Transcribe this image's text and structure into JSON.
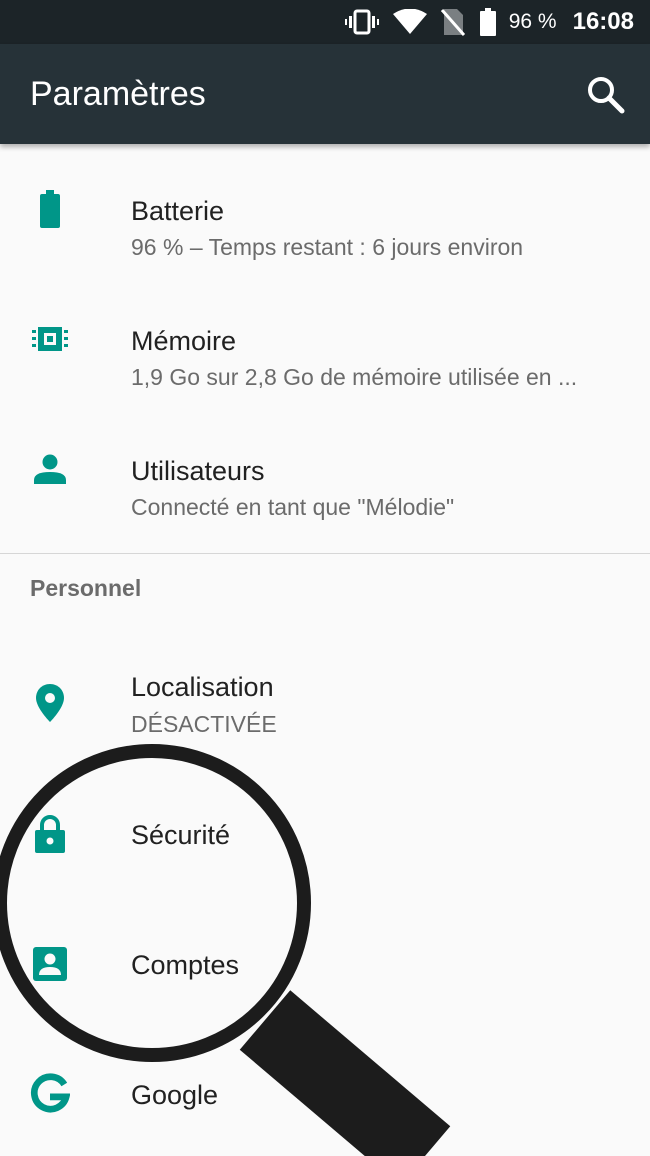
{
  "status_bar": {
    "icons": [
      "vibrate-icon",
      "wifi-icon",
      "no-sim-icon",
      "battery-icon"
    ],
    "battery_percent": "96 %",
    "time": "16:08"
  },
  "toolbar": {
    "title": "Paramètres",
    "search_icon": "search-icon"
  },
  "colors": {
    "toolbar": "#263238",
    "status_bar": "#1c2428",
    "accent": "#009688",
    "background": "#fafafa"
  },
  "items": [
    {
      "title": "Batterie",
      "subtitle": "96 % – Temps restant : 6 jours environ",
      "icon": "battery-icon"
    },
    {
      "title": "Mémoire",
      "subtitle": "1,9 Go sur 2,8 Go de mémoire utilisée en ...",
      "icon": "memory-chip-icon"
    },
    {
      "title": "Utilisateurs",
      "subtitle": "Connecté en tant que \"Mélodie\"",
      "icon": "person-icon"
    }
  ],
  "personal_section": {
    "header": "Personnel",
    "items": [
      {
        "title": "Localisation",
        "subtitle": "DÉSACTIVÉE",
        "icon": "location-pin-icon"
      },
      {
        "title": "Sécurité",
        "icon": "lock-icon"
      },
      {
        "title": "Comptes",
        "icon": "account-box-icon"
      },
      {
        "title": "Google",
        "icon": "google-icon"
      }
    ]
  }
}
